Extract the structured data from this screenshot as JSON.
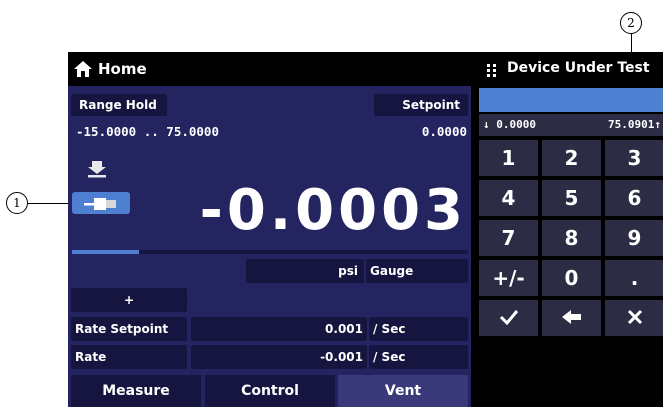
{
  "callouts": {
    "c1": "1",
    "c2": "2"
  },
  "header": {
    "home_label": "Home",
    "panel_title": "Device Under Test"
  },
  "range": {
    "label": "Range Hold",
    "value": "-15.0000 .. 75.0000"
  },
  "setpoint": {
    "label": "Setpoint",
    "value": "0.0000"
  },
  "reading": {
    "value": "-0.0003",
    "unit": "psi",
    "mode": "Gauge",
    "bar_level": 0.17
  },
  "rate_setpoint": {
    "button": "+",
    "label": "Rate Setpoint",
    "value": "0.001",
    "unit": "/ Sec"
  },
  "rate": {
    "label": "Rate",
    "value": "-0.001",
    "unit": "/ Sec"
  },
  "tabs": {
    "measure": "Measure",
    "control": "Control",
    "vent": "Vent"
  },
  "keypad": {
    "range_low": "↓ 0.0000",
    "range_high": "75.0901↑",
    "keys": [
      "1",
      "2",
      "3",
      "4",
      "5",
      "6",
      "7",
      "8",
      "9",
      "+/-",
      "0",
      ".",
      "✓",
      "🡐",
      "✕"
    ]
  },
  "colors": {
    "screen_bg": "#242461",
    "field_bg": "#15153f",
    "accent_blue": "#4f7fd1",
    "key_bg": "#2c2c44",
    "vent_tab": "#3a3a7a"
  },
  "icons": {
    "home": "home-icon",
    "grid": "grid-icon",
    "vent_down": "arrow-down-icon",
    "connector": "plug-icon"
  }
}
